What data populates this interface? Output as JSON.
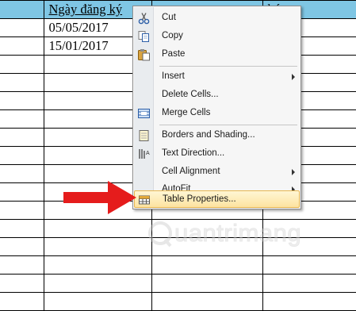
{
  "table": {
    "header": [
      "",
      "Ngày đăng ký",
      "",
      "hú"
    ],
    "rows": [
      [
        "",
        "05/05/2017",
        "",
        ""
      ],
      [
        "",
        "15/01/2017",
        "",
        ""
      ]
    ]
  },
  "context_menu": {
    "items": [
      {
        "label": "Cut",
        "icon": "scissors-icon"
      },
      {
        "label": "Copy",
        "icon": "copy-icon"
      },
      {
        "label": "Paste",
        "icon": "paste-icon"
      },
      {
        "label": "Insert",
        "submenu": true
      },
      {
        "label": "Delete Cells...",
        "icon": null
      },
      {
        "label": "Merge Cells",
        "icon": "merge-cells-icon"
      },
      {
        "label": "Borders and Shading...",
        "icon": "borders-shading-icon"
      },
      {
        "label": "Text Direction...",
        "icon": "text-direction-icon"
      },
      {
        "label": "Cell Alignment",
        "submenu": true
      },
      {
        "label": "AutoFit",
        "submenu": true
      },
      {
        "label": "Table Properties...",
        "icon": "table-properties-icon",
        "highlighted": true
      }
    ]
  },
  "watermark": {
    "text": "uantrimang"
  },
  "colors": {
    "header_fill": "#7fc6e4",
    "menu_bg": "#f6f6f6",
    "highlight": "#fde3a0",
    "arrow": "#e51c1c"
  }
}
